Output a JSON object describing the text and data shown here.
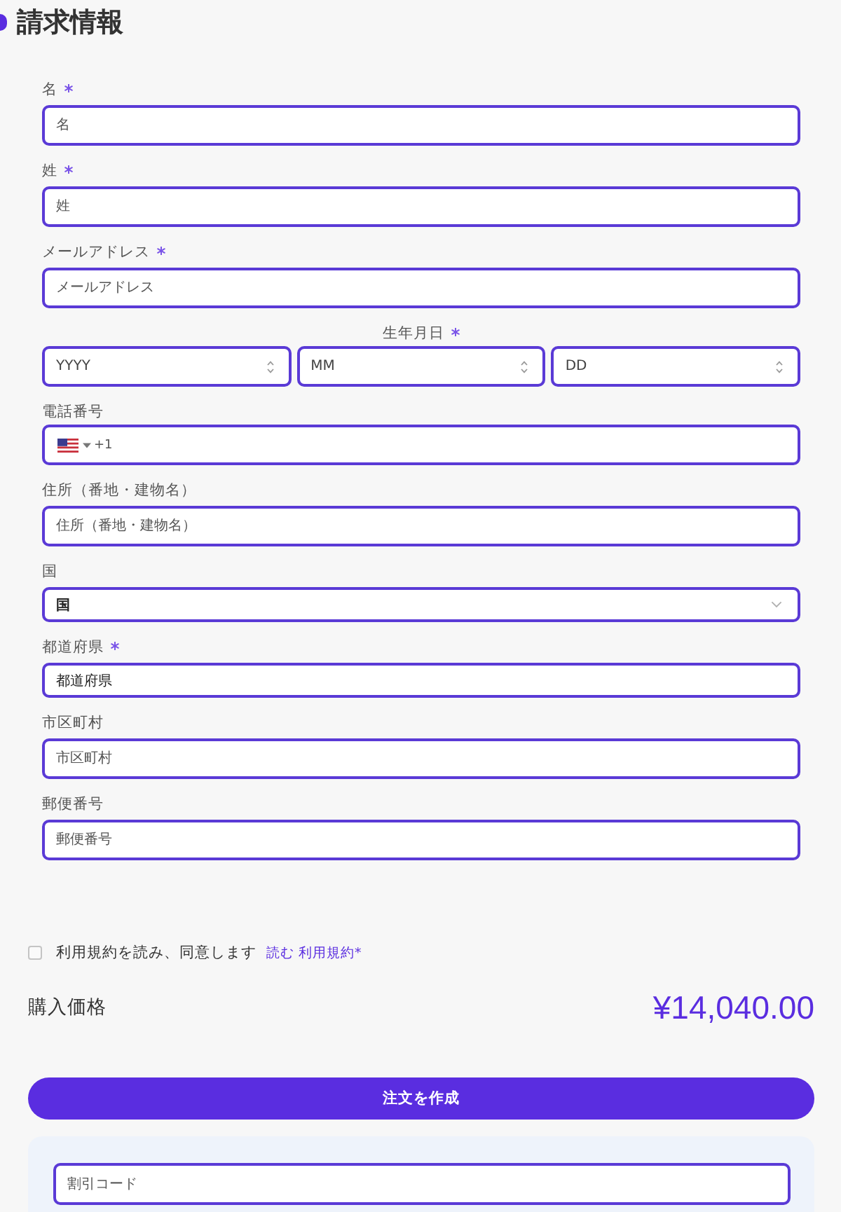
{
  "heading": {
    "title": "請求情報"
  },
  "fields": [
    {
      "kind": "text",
      "label": "名",
      "required": true,
      "placeholder": "名"
    },
    {
      "kind": "text",
      "label": "姓",
      "required": true,
      "placeholder": "姓"
    },
    {
      "kind": "text",
      "label": "メールアドレス",
      "required": true,
      "placeholder": "メールアドレス"
    },
    {
      "kind": "date",
      "label": "生年月日",
      "required": true,
      "parts": [
        {
          "placeholder": "YYYY"
        },
        {
          "placeholder": "MM"
        },
        {
          "placeholder": "DD"
        }
      ]
    },
    {
      "kind": "phone",
      "label": "電話番号",
      "required": false,
      "dial_code": "+1"
    },
    {
      "kind": "text",
      "label": "住所（番地・建物名）",
      "required": false,
      "placeholder": "住所（番地・建物名）"
    },
    {
      "kind": "select",
      "label": "国",
      "required": false,
      "value": "国"
    },
    {
      "kind": "text",
      "label": "都道府県",
      "required": true,
      "value": "都道府県"
    },
    {
      "kind": "text",
      "label": "市区町村",
      "required": false,
      "placeholder": "市区町村"
    },
    {
      "kind": "text",
      "label": "郵便番号",
      "required": false,
      "placeholder": "郵便番号"
    }
  ],
  "terms": {
    "checked": false,
    "text": "利用規約を読み、同意します",
    "link": "読む 利用規約*"
  },
  "total": {
    "label": "購入価格",
    "amount": "¥14,040.00"
  },
  "submit_button": {
    "label": "注文を作成"
  },
  "discount": {
    "placeholder": "割引コード"
  }
}
